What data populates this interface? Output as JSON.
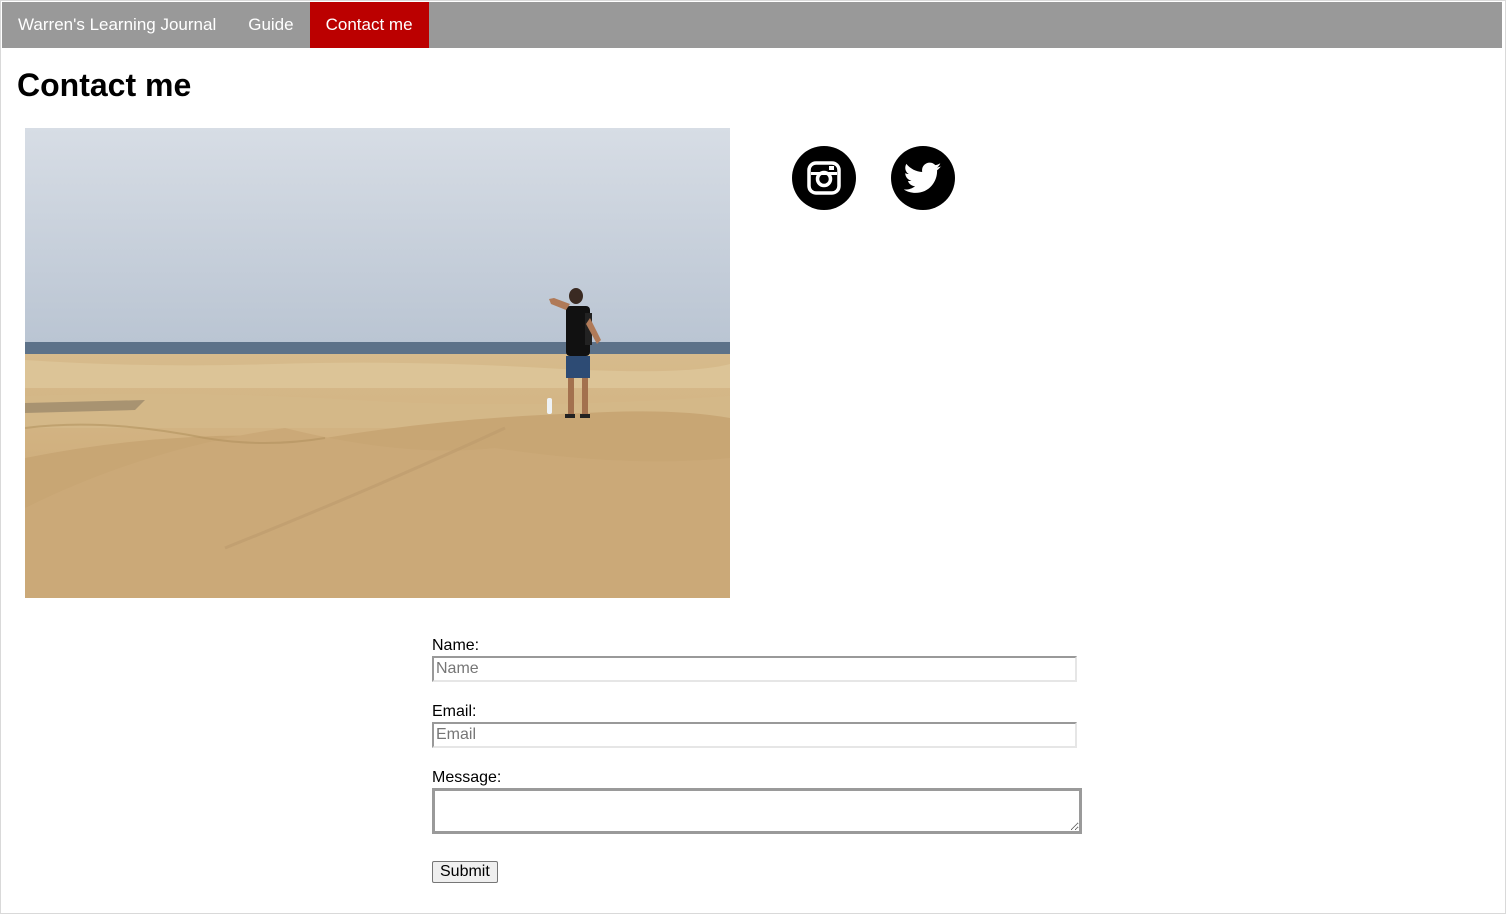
{
  "nav": {
    "items": [
      {
        "label": "Warren's Learning Journal"
      },
      {
        "label": "Guide"
      },
      {
        "label": "Contact me"
      }
    ]
  },
  "page": {
    "title": "Contact me"
  },
  "photo": {
    "subject": "person standing on sand dunes with the sea on the horizon"
  },
  "social": {
    "instagram_icon": "instagram-icon",
    "twitter_icon": "twitter-icon"
  },
  "form": {
    "name_label": "Name:",
    "name_placeholder": "Name",
    "name_value": "",
    "email_label": "Email:",
    "email_placeholder": "Email",
    "email_value": "",
    "message_label": "Message:",
    "message_value": "",
    "submit_label": "Submit"
  },
  "colors": {
    "nav_background": "#999999",
    "nav_active": "#bb0000",
    "nav_text": "#ffffff",
    "icon_background": "#000000"
  }
}
